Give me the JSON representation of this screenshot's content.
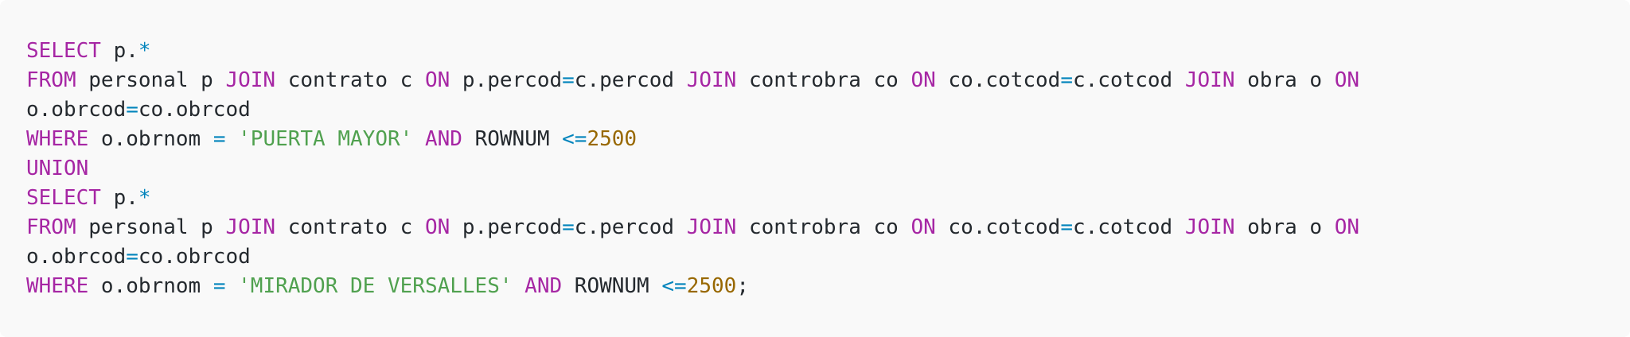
{
  "colors": {
    "background": "#f9f9f9",
    "keyword": "#a626a4",
    "operator": "#0184bc",
    "string": "#50a14f",
    "number": "#986801",
    "plain": "#24292e"
  },
  "code": {
    "language": "sql",
    "lines": [
      [
        {
          "t": "kw",
          "v": "SELECT"
        },
        {
          "t": "pl",
          "v": " p."
        },
        {
          "t": "op",
          "v": "*"
        }
      ],
      [
        {
          "t": "kw",
          "v": "FROM"
        },
        {
          "t": "pl",
          "v": " personal p "
        },
        {
          "t": "kw",
          "v": "JOIN"
        },
        {
          "t": "pl",
          "v": " contrato c "
        },
        {
          "t": "kw",
          "v": "ON"
        },
        {
          "t": "pl",
          "v": " p.percod"
        },
        {
          "t": "op",
          "v": "="
        },
        {
          "t": "pl",
          "v": "c.percod "
        },
        {
          "t": "kw",
          "v": "JOIN"
        },
        {
          "t": "pl",
          "v": " controbra co "
        },
        {
          "t": "kw",
          "v": "ON"
        },
        {
          "t": "pl",
          "v": " co.cotcod"
        },
        {
          "t": "op",
          "v": "="
        },
        {
          "t": "pl",
          "v": "c.cotcod "
        },
        {
          "t": "kw",
          "v": "JOIN"
        },
        {
          "t": "pl",
          "v": " obra o "
        },
        {
          "t": "kw",
          "v": "ON"
        }
      ],
      [
        {
          "t": "pl",
          "v": "o.obrcod"
        },
        {
          "t": "op",
          "v": "="
        },
        {
          "t": "pl",
          "v": "co.obrcod"
        }
      ],
      [
        {
          "t": "kw",
          "v": "WHERE"
        },
        {
          "t": "pl",
          "v": " o.obrnom "
        },
        {
          "t": "op",
          "v": "="
        },
        {
          "t": "pl",
          "v": " "
        },
        {
          "t": "str",
          "v": "'PUERTA MAYOR'"
        },
        {
          "t": "pl",
          "v": " "
        },
        {
          "t": "kw",
          "v": "AND"
        },
        {
          "t": "pl",
          "v": " ROWNUM "
        },
        {
          "t": "op",
          "v": "<="
        },
        {
          "t": "num",
          "v": "2500"
        }
      ],
      [
        {
          "t": "kw",
          "v": "UNION"
        }
      ],
      [
        {
          "t": "kw",
          "v": "SELECT"
        },
        {
          "t": "pl",
          "v": " p."
        },
        {
          "t": "op",
          "v": "*"
        }
      ],
      [
        {
          "t": "kw",
          "v": "FROM"
        },
        {
          "t": "pl",
          "v": " personal p "
        },
        {
          "t": "kw",
          "v": "JOIN"
        },
        {
          "t": "pl",
          "v": " contrato c "
        },
        {
          "t": "kw",
          "v": "ON"
        },
        {
          "t": "pl",
          "v": " p.percod"
        },
        {
          "t": "op",
          "v": "="
        },
        {
          "t": "pl",
          "v": "c.percod "
        },
        {
          "t": "kw",
          "v": "JOIN"
        },
        {
          "t": "pl",
          "v": " controbra co "
        },
        {
          "t": "kw",
          "v": "ON"
        },
        {
          "t": "pl",
          "v": " co.cotcod"
        },
        {
          "t": "op",
          "v": "="
        },
        {
          "t": "pl",
          "v": "c.cotcod "
        },
        {
          "t": "kw",
          "v": "JOIN"
        },
        {
          "t": "pl",
          "v": " obra o "
        },
        {
          "t": "kw",
          "v": "ON"
        }
      ],
      [
        {
          "t": "pl",
          "v": "o.obrcod"
        },
        {
          "t": "op",
          "v": "="
        },
        {
          "t": "pl",
          "v": "co.obrcod"
        }
      ],
      [
        {
          "t": "kw",
          "v": "WHERE"
        },
        {
          "t": "pl",
          "v": " o.obrnom "
        },
        {
          "t": "op",
          "v": "="
        },
        {
          "t": "pl",
          "v": " "
        },
        {
          "t": "str",
          "v": "'MIRADOR DE VERSALLES'"
        },
        {
          "t": "pl",
          "v": " "
        },
        {
          "t": "kw",
          "v": "AND"
        },
        {
          "t": "pl",
          "v": " ROWNUM "
        },
        {
          "t": "op",
          "v": "<="
        },
        {
          "t": "num",
          "v": "2500"
        },
        {
          "t": "pl",
          "v": ";"
        }
      ]
    ]
  }
}
